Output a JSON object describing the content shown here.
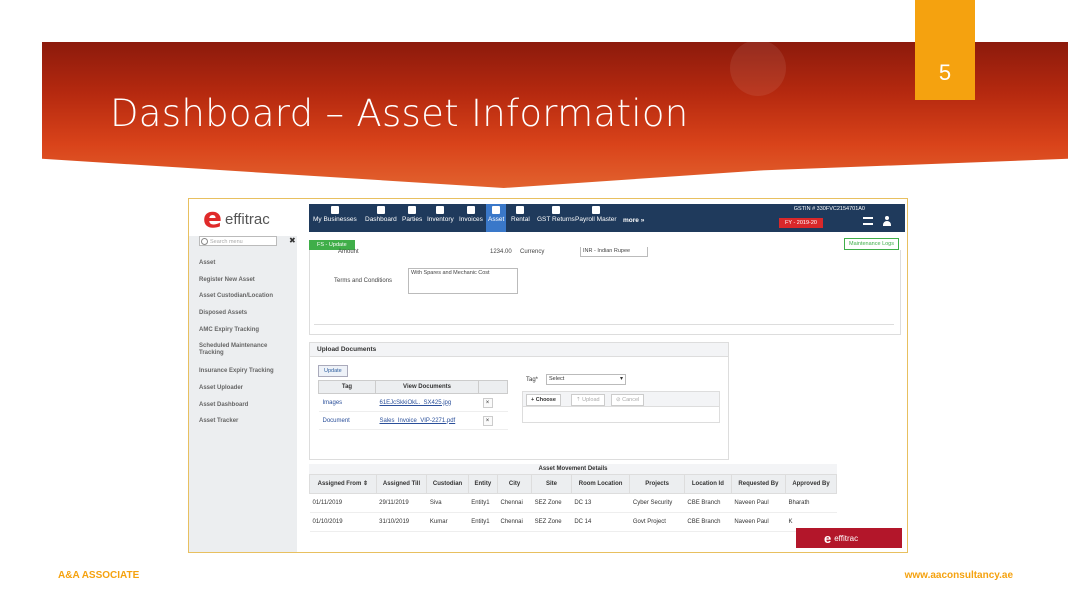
{
  "slide": {
    "title": "Dashboard – Asset Information",
    "page_number": "5",
    "footer_left": "A&A ASSOCIATE",
    "footer_right": "www.aaconsultancy.ae",
    "colors": {
      "banner": "#b5290f",
      "accent": "#f5a20f"
    }
  },
  "app": {
    "logo_mark": "e",
    "logo_text": "effitrac",
    "nav": [
      {
        "label": "My Businesses",
        "icon": "briefcase-icon"
      },
      {
        "label": "Dashboard",
        "icon": "monitor-icon"
      },
      {
        "label": "Parties",
        "icon": "users-icon"
      },
      {
        "label": "Inventory",
        "icon": "chart-icon"
      },
      {
        "label": "Invoices",
        "icon": "document-icon"
      },
      {
        "label": "Asset",
        "icon": "chart-icon",
        "active": true
      },
      {
        "label": "Rental",
        "icon": "chart-icon"
      },
      {
        "label": "GST Returns",
        "icon": "gst-icon"
      },
      {
        "label": "Payroll Master",
        "icon": "user-icon"
      },
      {
        "label": "more »",
        "icon": ""
      }
    ],
    "gstin": "GSTIN # 330FVC2154701A0",
    "fy": "FY - 2019-20",
    "search_placeholder": "Search menu",
    "sidebar": [
      "Asset",
      "Register New Asset",
      "Asset Custodian/Location",
      "Disposed Assets",
      "AMC Expiry Tracking",
      "Scheduled Maintenance Tracking",
      "Insurance Expiry Tracking",
      "Asset Uploader",
      "Asset Dashboard",
      "Asset Tracker"
    ],
    "fs_update": "FS - Update",
    "maintenance_logs": "Maintenance Logs",
    "form": {
      "amount_label": "Amount",
      "amount_value": "1234.00",
      "currency_label": "Currency",
      "currency_value": "INR - Indian Rupee",
      "terms_label": "Terms and Conditions",
      "terms_value": "With Spares and Mechanic Cost"
    },
    "upload": {
      "title": "Upload Documents",
      "update_label": "Update",
      "headers": [
        "Tag",
        "View Documents"
      ],
      "rows": [
        {
          "tag": "Images",
          "doc": "61EJcSkkiOkL._SX425.jpg"
        },
        {
          "tag": "Document",
          "doc": "Sales_Invoice_VIP-2271.pdf"
        }
      ],
      "delete_glyph": "×",
      "tag_label": "Tag*",
      "tag_select": "Select",
      "choose": "+ Choose",
      "upload_btn": "⇡ Upload",
      "cancel_btn": "⊘ Cancel"
    },
    "movement": {
      "title": "Asset Movement Details",
      "headers": [
        "Assigned From ⇕",
        "Assigned Till",
        "Custodian",
        "Entity",
        "City",
        "Site",
        "Room Location",
        "Projects",
        "Location Id",
        "Requested By",
        "Approved By"
      ],
      "rows": [
        [
          "01/11/2019",
          "29/11/2019",
          "Siva",
          "Entity1",
          "Chennai",
          "SEZ Zone",
          "DC 13",
          "Cyber Security",
          "CBE Branch",
          "Naveen Paul",
          "Bharath"
        ],
        [
          "01/10/2019",
          "31/10/2019",
          "Kumar",
          "Entity1",
          "Chennai",
          "SEZ Zone",
          "DC 14",
          "Govt Project",
          "CBE Branch",
          "Naveen Paul",
          "K"
        ]
      ]
    },
    "badge_text": "effitrac"
  }
}
